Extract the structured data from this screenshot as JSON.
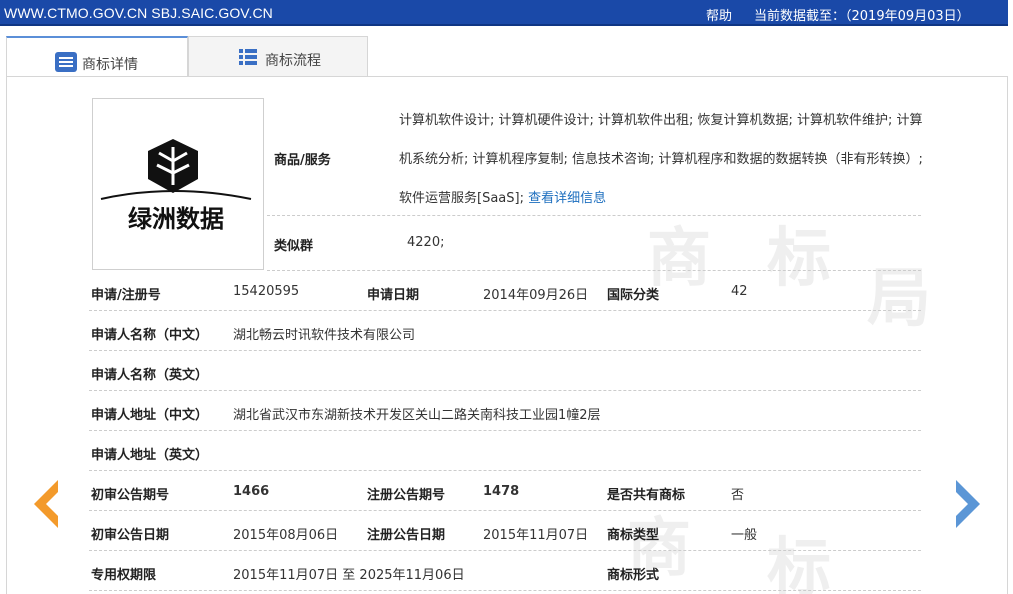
{
  "topbar": {
    "site": "WWW.CTMO.GOV.CN SBJ.SAIC.GOV.CN",
    "help": "帮助",
    "data_as_of": "当前数据截至：（2019年09月03日）"
  },
  "tabs": [
    {
      "label": "商标详情",
      "icon": "list-icon",
      "active": true
    },
    {
      "label": "商标流程",
      "icon": "grid-list-icon",
      "active": false
    }
  ],
  "watermark": [
    "商",
    "标",
    "局",
    "商",
    "标"
  ],
  "logo": {
    "text": "绿洲数据"
  },
  "goods": {
    "label": "商品/服务",
    "text": "计算机软件设计; 计算机硬件设计; 计算机软件出租; 恢复计算机数据; 计算机软件维护; 计算机系统分析; 计算机程序复制; 信息技术咨询; 计算机程序和数据的数据转换（非有形转换）; 软件运营服务[SaaS]; ",
    "more_link": "查看详细信息"
  },
  "similar_group": {
    "label": "类似群",
    "value": "4220;"
  },
  "rows": {
    "reg_no": {
      "label": "申请/注册号",
      "value": "15420595"
    },
    "apply_date": {
      "label": "申请日期",
      "value": "2014年09月26日"
    },
    "intl_class": {
      "label": "国际分类",
      "value": "42"
    },
    "applicant_cn": {
      "label": "申请人名称（中文）",
      "value": "湖北畅云时讯软件技术有限公司"
    },
    "applicant_en": {
      "label": "申请人名称（英文）",
      "value": ""
    },
    "address_cn": {
      "label": "申请人地址（中文）",
      "value": "湖北省武汉市东湖新技术开发区关山二路关南科技工业园1幢2层"
    },
    "address_en": {
      "label": "申请人地址（英文）",
      "value": ""
    },
    "prelim_issue": {
      "label": "初审公告期号",
      "value": "1466"
    },
    "reg_issue": {
      "label": "注册公告期号",
      "value": "1478"
    },
    "shared": {
      "label": "是否共有商标",
      "value": "否"
    },
    "prelim_date": {
      "label": "初审公告日期",
      "value": "2015年08月06日"
    },
    "reg_date": {
      "label": "注册公告日期",
      "value": "2015年11月07日"
    },
    "tm_type": {
      "label": "商标类型",
      "value": "一般"
    },
    "exclusive": {
      "label": "专用权期限",
      "value": "2015年11月07日 至 2025年11月06日"
    },
    "tm_form": {
      "label": "商标形式",
      "value": ""
    }
  },
  "colors": {
    "topbar": "#1a49a8",
    "prev_arrow": "#f39a2b",
    "next_arrow": "#5b96d6",
    "link": "#1e6fbf"
  }
}
